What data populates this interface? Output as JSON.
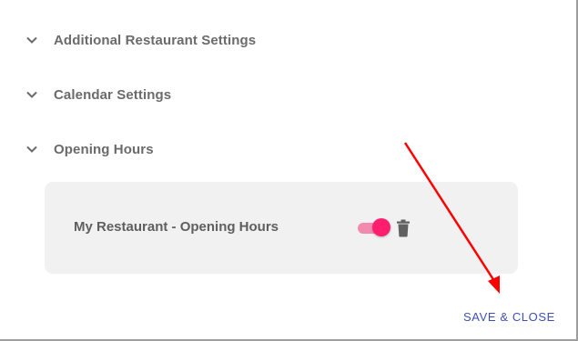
{
  "sections": [
    {
      "label": "Additional Restaurant Settings",
      "icon": "chevron-down-icon"
    },
    {
      "label": "Calendar Settings",
      "icon": "chevron-down-icon"
    },
    {
      "label": "Opening Hours",
      "icon": "chevron-down-icon"
    }
  ],
  "opening_hours": {
    "item_label": "My Restaurant - Opening Hours",
    "toggle_on": true,
    "toggle_icon": "toggle-switch-icon",
    "delete_icon": "trash-icon"
  },
  "footer": {
    "save_close_label": "SAVE & CLOSE"
  },
  "annotation": {
    "arrow_color": "#ff0000"
  },
  "colors": {
    "accent": "#ff1f6e",
    "toggle_track": "#f28ab0",
    "link": "#3f51b5",
    "label": "#6b6b6b",
    "card_bg": "#f1f1f1"
  }
}
